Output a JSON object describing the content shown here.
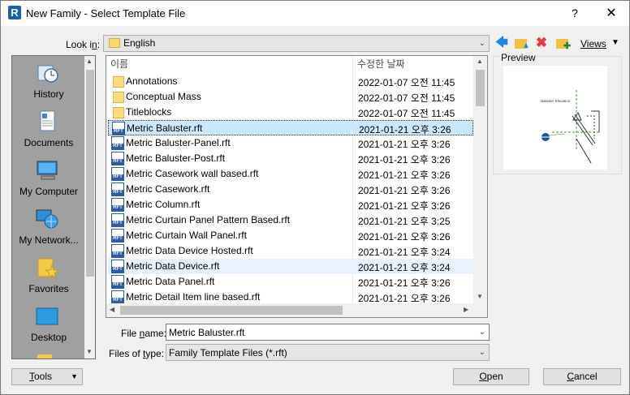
{
  "window": {
    "title": "New Family - Select Template File",
    "app_icon_letter": "R",
    "help_label": "?",
    "close_label": "✕"
  },
  "toolbar": {
    "look_in_label": "Look in:",
    "look_in_value": "English",
    "views_label": "Views"
  },
  "places": [
    {
      "label": "History",
      "icon": "history-icon"
    },
    {
      "label": "Documents",
      "icon": "documents-icon"
    },
    {
      "label": "My Computer",
      "icon": "computer-icon"
    },
    {
      "label": "My Network...",
      "icon": "network-icon"
    },
    {
      "label": "Favorites",
      "icon": "favorites-icon"
    },
    {
      "label": "Desktop",
      "icon": "desktop-icon"
    }
  ],
  "filelist": {
    "columns": {
      "name": "이름",
      "date": "수정한 날짜"
    },
    "rows": [
      {
        "type": "folder",
        "name": "Annotations",
        "date": "2022-01-07 오전 11:45"
      },
      {
        "type": "folder",
        "name": "Conceptual Mass",
        "date": "2022-01-07 오전 11:45"
      },
      {
        "type": "folder",
        "name": "Titleblocks",
        "date": "2022-01-07 오전 11:45"
      },
      {
        "type": "rft",
        "name": "Metric Baluster.rft",
        "date": "2021-01-21 오후 3:26",
        "state": "selected"
      },
      {
        "type": "rft",
        "name": "Metric Baluster-Panel.rft",
        "date": "2021-01-21 오후 3:26"
      },
      {
        "type": "rft",
        "name": "Metric Baluster-Post.rft",
        "date": "2021-01-21 오후 3:26"
      },
      {
        "type": "rft",
        "name": "Metric Casework wall based.rft",
        "date": "2021-01-21 오후 3:26"
      },
      {
        "type": "rft",
        "name": "Metric Casework.rft",
        "date": "2021-01-21 오후 3:26"
      },
      {
        "type": "rft",
        "name": "Metric Column.rft",
        "date": "2021-01-21 오후 3:26"
      },
      {
        "type": "rft",
        "name": "Metric Curtain Panel Pattern Based.rft",
        "date": "2021-01-21 오후 3:25"
      },
      {
        "type": "rft",
        "name": "Metric Curtain Wall Panel.rft",
        "date": "2021-01-21 오후 3:26"
      },
      {
        "type": "rft",
        "name": "Metric Data Device Hosted.rft",
        "date": "2021-01-21 오후 3:24"
      },
      {
        "type": "rft",
        "name": "Metric Data Device.rft",
        "date": "2021-01-21 오후 3:24",
        "state": "hover"
      },
      {
        "type": "rft",
        "name": "Metric Data Panel.rft",
        "date": "2021-01-21 오후 3:26"
      },
      {
        "type": "rft",
        "name": "Metric Detail Item line based.rft",
        "date": "2021-01-21 오후 3:26"
      }
    ]
  },
  "preview": {
    "label": "Preview",
    "drawing_caption": "Baluster Elevation"
  },
  "form": {
    "file_name_label": "File name:",
    "file_name_value": "Metric Baluster.rft",
    "files_of_type_label": "Files of type:",
    "files_of_type_value": "Family Template Files  (*.rft)"
  },
  "buttons": {
    "tools": "Tools",
    "open": "Open",
    "cancel": "Cancel"
  }
}
